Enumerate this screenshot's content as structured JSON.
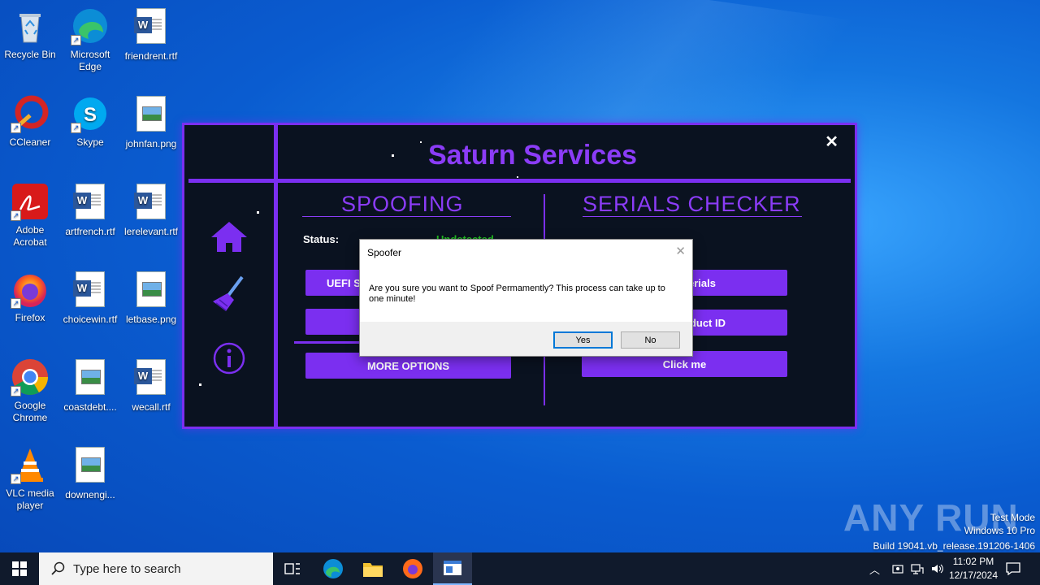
{
  "desktop": {
    "icons": [
      {
        "label": "Recycle Bin",
        "icon": "recycle-bin-icon"
      },
      {
        "label": "Microsoft Edge",
        "icon": "edge-icon"
      },
      {
        "label": "friendrent.rtf",
        "icon": "word-doc-icon"
      },
      {
        "label": "CCleaner",
        "icon": "ccleaner-icon"
      },
      {
        "label": "Skype",
        "icon": "skype-icon"
      },
      {
        "label": "johnfan.png",
        "icon": "image-file-icon"
      },
      {
        "label": "Adobe Acrobat",
        "icon": "acrobat-icon"
      },
      {
        "label": "artfrench.rtf",
        "icon": "word-doc-icon"
      },
      {
        "label": "lerelevant.rtf",
        "icon": "word-doc-icon"
      },
      {
        "label": "Firefox",
        "icon": "firefox-icon"
      },
      {
        "label": "choicewin.rtf",
        "icon": "word-doc-icon"
      },
      {
        "label": "letbase.png",
        "icon": "image-file-icon"
      },
      {
        "label": "Google Chrome",
        "icon": "chrome-icon"
      },
      {
        "label": "coastdebt....",
        "icon": "image-file-icon"
      },
      {
        "label": "wecall.rtf",
        "icon": "word-doc-icon"
      },
      {
        "label": "VLC media player",
        "icon": "vlc-icon"
      },
      {
        "label": "downengi...",
        "icon": "image-file-icon"
      }
    ]
  },
  "app": {
    "title": "Saturn Services",
    "close": "✕",
    "spoofing": {
      "title": "SPOOFING",
      "status_label": "Status:",
      "status_value": "Undetected",
      "btn_uefi": "UEFI Sp",
      "btn_more": "MORE OPTIONS"
    },
    "serials": {
      "title": "SERIALS CHECKER",
      "btn_serials": "erials",
      "btn_product": "duct ID",
      "btn_click": "Click me"
    },
    "colors": {
      "accent": "#7b2ff0",
      "title": "#8b3cf7",
      "status": "#22c322",
      "bg": "#0a1220"
    }
  },
  "dialog": {
    "title": "Spoofer",
    "close": "✕",
    "message": "Are you sure you want to Spoof Permamently? This process can take up to one minute!",
    "yes": "Yes",
    "no": "No"
  },
  "watermark": {
    "brand": "ANY RUN",
    "line1": "Test Mode",
    "line2": "Windows 10 Pro",
    "line3": "Build 19041.vb_release.191206-1406"
  },
  "taskbar": {
    "search_placeholder": "Type here to search",
    "time": "11:02 PM",
    "date": "12/17/2024"
  }
}
